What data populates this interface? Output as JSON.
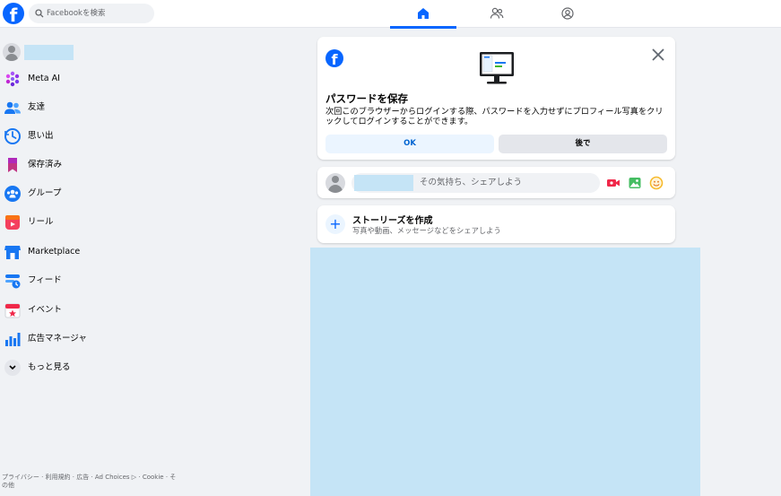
{
  "topbar": {
    "search_placeholder": "Facebookを検索",
    "tabs": [
      {
        "icon": "home-icon",
        "active": true
      },
      {
        "icon": "friends-icon",
        "active": false
      },
      {
        "icon": "profile-circle-icon",
        "active": false
      }
    ]
  },
  "sidebar": {
    "items": [
      {
        "label": "Meta AI",
        "icon": "meta-ai-icon"
      },
      {
        "label": "友達",
        "icon": "friends-icon"
      },
      {
        "label": "思い出",
        "icon": "memories-icon"
      },
      {
        "label": "保存済み",
        "icon": "bookmark-icon"
      },
      {
        "label": "グループ",
        "icon": "groups-icon"
      },
      {
        "label": "リール",
        "icon": "reels-icon"
      },
      {
        "label": "Marketplace",
        "icon": "marketplace-icon"
      },
      {
        "label": "フィード",
        "icon": "feed-icon"
      },
      {
        "label": "イベント",
        "icon": "events-icon"
      },
      {
        "label": "広告マネージャ",
        "icon": "ads-manager-icon"
      },
      {
        "label": "もっと見る",
        "icon": "chevron-down-icon"
      }
    ],
    "footer": "プライバシー · 利用規約 · 広告 · Ad Choices ▷ · Cookie · その他"
  },
  "save_password": {
    "title": "パスワードを保存",
    "description": "次回このブラウザーからログインする際、パスワードを入力せずにプロフィール写真をクリックしてログインすることができます。",
    "ok_label": "OK",
    "later_label": "後で"
  },
  "composer": {
    "placeholder": "その気持ち、シェアしよう"
  },
  "story": {
    "title": "ストーリーズを作成",
    "subtitle": "写真や動画、メッセージなどをシェアしよう"
  },
  "colors": {
    "brand": "#0866ff",
    "background": "#f0f2f5",
    "redaction": "#c5e4f6"
  }
}
